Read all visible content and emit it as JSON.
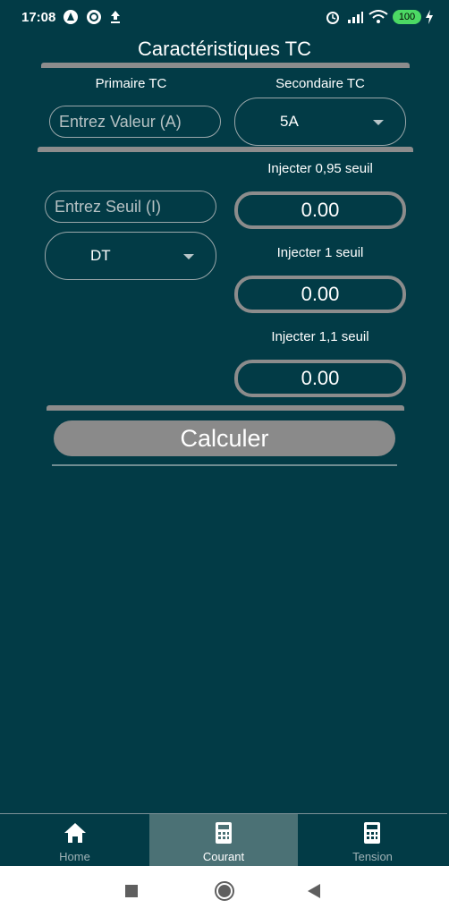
{
  "status_bar": {
    "time": "17:08",
    "battery": "100"
  },
  "header": {
    "title": "Caractéristiques TC"
  },
  "primaire": {
    "label": "Primaire TC",
    "placeholder": "Entrez Valeur (A)"
  },
  "secondaire": {
    "label": "Secondaire TC",
    "selected": "5A"
  },
  "seuil": {
    "placeholder": "Entrez Seuil (I)"
  },
  "mode": {
    "selected": "DT"
  },
  "injections": [
    {
      "label": "Injecter 0,95 seuil",
      "value": "0.00"
    },
    {
      "label": "Injecter 1 seuil",
      "value": "0.00"
    },
    {
      "label": "Injecter 1,1 seuil",
      "value": "0.00"
    }
  ],
  "calculate": {
    "label": "Calculer"
  },
  "bottom_nav": {
    "items": [
      {
        "label": "Home",
        "icon": "home-icon",
        "active": false
      },
      {
        "label": "Courant",
        "icon": "calculator-icon",
        "active": true
      },
      {
        "label": "Tension",
        "icon": "calculator-icon",
        "active": false
      }
    ]
  },
  "colors": {
    "background": "#023b46",
    "accent_gray": "#8a8a8a",
    "active_tab": "#4b7175"
  }
}
